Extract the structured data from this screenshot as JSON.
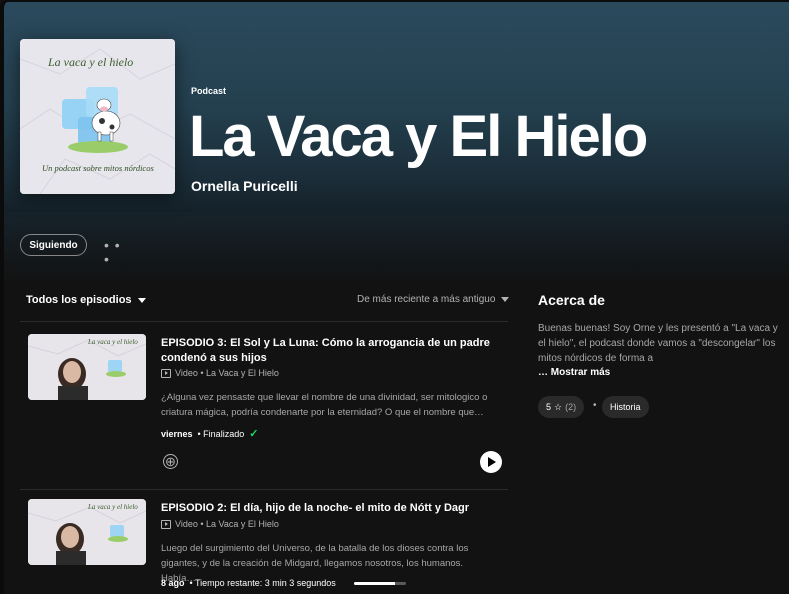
{
  "show": {
    "kind": "Podcast",
    "title": "La Vaca y El Hielo",
    "author": "Ornella Puricelli",
    "cover_title": "La vaca y el hielo",
    "cover_subtitle": "Un podcast sobre mitos nórdicos"
  },
  "actions": {
    "follow_label": "Siguiendo",
    "more_label": "• • •"
  },
  "episodes_list": {
    "filter_label": "Todos los episodios",
    "sort_label": "De más reciente a más antiguo"
  },
  "episodes": [
    {
      "title": "EPISODIO 3: El Sol y La Luna: Cómo la arrogancia de un padre condenó a sus hijos",
      "meta": "Video • La Vaca y El Hielo",
      "description": "¿Alguna vez pensaste que llevar el nombre de una divinidad, ser mitologico o criatura mágica, podría condenarte por la eternidad? O que el nombre que…",
      "date": "viernes",
      "status": "• Finalizado",
      "check_icon": "✓"
    },
    {
      "title": "EPISODIO 2: El día, hijo de la noche- el mito de Nótt y Dagr",
      "meta": "Video • La Vaca y El Hielo",
      "description": "Luego del surgimiento del Universo, de la batalla de los dioses contra los gigantes, y de la creación de Midgard, llegamos nosotros, los humanos. Había…",
      "date": "8 ago",
      "status": "• Tiempo restante: 3 min 3 segundos",
      "progress": 0.78
    }
  ],
  "about": {
    "heading": "Acerca de",
    "text": "Buenas buenas! Soy Orne y les presentó a \"La vaca y el hielo\", el podcast donde vamos a \"descongelar\" los mitos nórdicos de forma a",
    "more_label": "… Mostrar más",
    "rating": "5",
    "rating_count": "(2)",
    "category": "Historia"
  },
  "icons": {
    "add": "⊕",
    "play": "play-icon",
    "video": "video-icon",
    "star": "☆"
  },
  "colors": {
    "accent_green": "#1ed760",
    "hero_top": "#2b4a5d",
    "background": "#121212"
  }
}
